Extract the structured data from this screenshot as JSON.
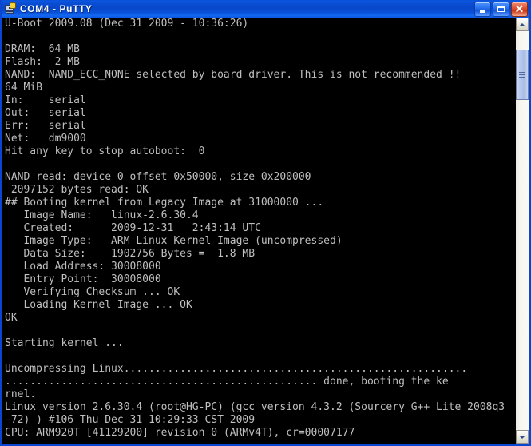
{
  "window": {
    "title": "COM4 - PuTTY",
    "icon": "putty-computer-plug-icon"
  },
  "caption_buttons": {
    "minimize": "_",
    "maximize": "□",
    "close": "✕"
  },
  "scrollbar": {
    "up_arrow": "▲",
    "down_arrow": "▼"
  },
  "colors": {
    "titlebar_blue": "#0a50d8",
    "frame_blue": "#0a46d2",
    "close_red": "#c83a18",
    "terminal_bg": "#000000",
    "terminal_fg": "#bfbfbf"
  },
  "terminal": {
    "cols": 80,
    "rows": 33,
    "lines": [
      "U-Boot 2009.08 (Dec 31 2009 - 10:36:26)",
      "",
      "DRAM:  64 MB",
      "Flash:  2 MB",
      "NAND:  NAND_ECC_NONE selected by board driver. This is not recommended !!",
      "64 MiB",
      "In:    serial",
      "Out:   serial",
      "Err:   serial",
      "Net:   dm9000",
      "Hit any key to stop autoboot:  0",
      "",
      "NAND read: device 0 offset 0x50000, size 0x200000",
      " 2097152 bytes read: OK",
      "## Booting kernel from Legacy Image at 31000000 ...",
      "   Image Name:   linux-2.6.30.4",
      "   Created:      2009-12-31   2:43:14 UTC",
      "   Image Type:   ARM Linux Kernel Image (uncompressed)",
      "   Data Size:    1902756 Bytes =  1.8 MB",
      "   Load Address: 30008000",
      "   Entry Point:  30008000",
      "   Verifying Checksum ... OK",
      "   Loading Kernel Image ... OK",
      "OK",
      "",
      "Starting kernel ...",
      "",
      "Uncompressing Linux.......................................................",
      ".................................................. done, booting the ke",
      "rnel.",
      "Linux version 2.6.30.4 (root@HG-PC) (gcc version 4.3.2 (Sourcery G++ Lite 2008q3",
      "-72) ) #106 Thu Dec 31 10:29:33 CST 2009",
      "CPU: ARM920T [41129200] revision 0 (ARMv4T), cr=00007177"
    ]
  }
}
